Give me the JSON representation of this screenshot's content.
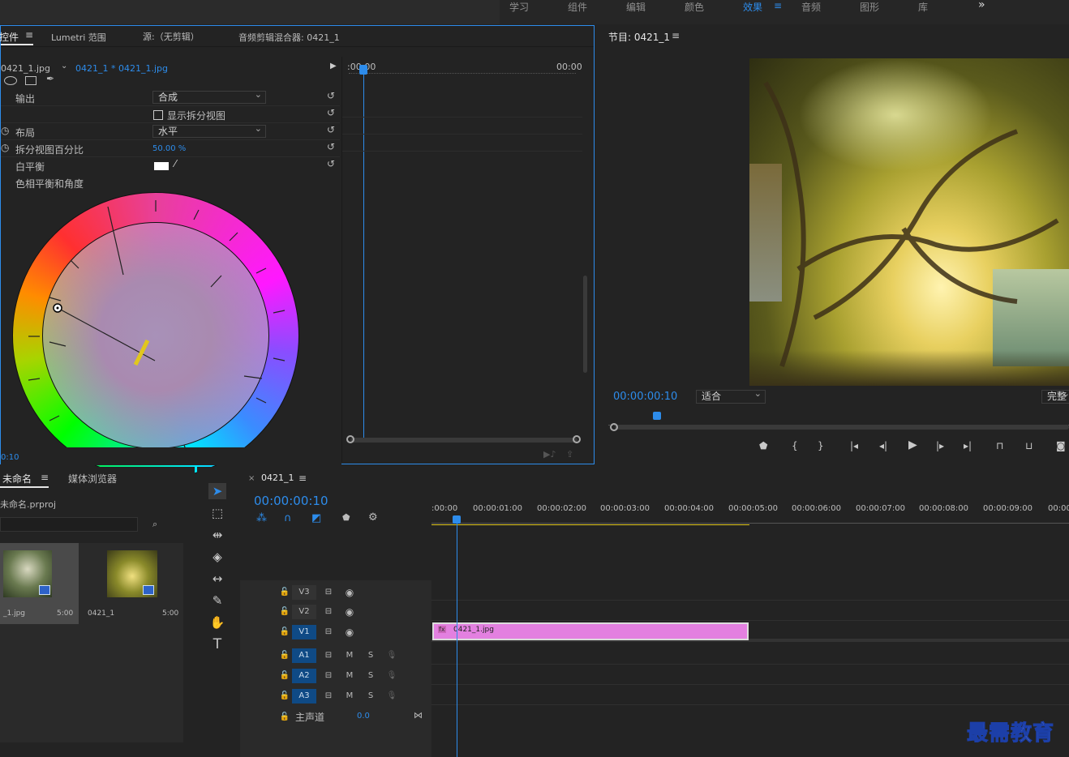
{
  "workspaces": [
    "学习",
    "组件",
    "编辑",
    "颜色",
    "效果",
    "音频",
    "图形",
    "库"
  ],
  "workspace_active": "效果",
  "workspace_more": "»",
  "ec": {
    "tabs": [
      "控件",
      "Lumetri 范围",
      "源:（无剪辑）",
      "音频剪辑混合器: 0421_1"
    ],
    "menu_glyph": "≡",
    "source_clip": "0421_1.jpg",
    "sequence_clip": "0421_1 * 0421_1.jpg",
    "ruler_start": ":00:00",
    "ruler_end": "00:00",
    "output_label": "输出",
    "output_value": "合成",
    "split_view_label": "显示拆分视图",
    "layout_label": "布局",
    "layout_value": "水平",
    "split_percent_label": "拆分视图百分比",
    "split_percent_value": "50.00 %",
    "wb_label": "白平衡",
    "hue_label": "色相平衡和角度",
    "time": "0:10"
  },
  "pm": {
    "title": "节目: 0421_1",
    "timecode": "00:00:00:10",
    "fit": "适合",
    "quality": "完整"
  },
  "pp": {
    "tabs": [
      "未命名",
      "媒体浏览器"
    ],
    "project_file": "未命名.prproj",
    "items": [
      {
        "name": "_1.jpg",
        "duration": "5:00"
      },
      {
        "name": "0421_1",
        "duration": "5:00"
      }
    ]
  },
  "tl": {
    "seq_name": "0421_1",
    "timecode": "00:00:00:10",
    "ruler": [
      ":00:00",
      "00:00:01:00",
      "00:00:02:00",
      "00:00:03:00",
      "00:00:04:00",
      "00:00:05:00",
      "00:00:06:00",
      "00:00:07:00",
      "00:00:08:00",
      "00:00:09:00",
      "00:00"
    ],
    "video_tracks": [
      "V3",
      "V2",
      "V1"
    ],
    "audio_tracks": [
      "A1",
      "A2",
      "A3"
    ],
    "master": "主声道",
    "master_value": "0.0",
    "clip_name": "0421_1.jpg",
    "fx": "fx",
    "mute": "M",
    "solo": "S"
  },
  "watermark": "最需教育",
  "colors": {
    "accent": "#2d8ceb",
    "clip": "#e380e0",
    "yellow": "#e1c71c"
  }
}
